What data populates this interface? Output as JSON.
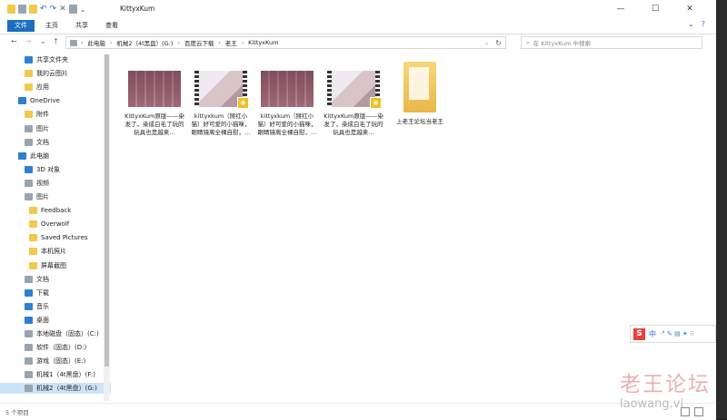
{
  "window": {
    "title": "KittyxKum",
    "controls": {
      "minimize": "—",
      "maximize": "☐",
      "close": "✕"
    }
  },
  "ribbon": {
    "tabs": [
      "文件",
      "主页",
      "共享",
      "查看"
    ]
  },
  "navigation": {
    "back": "←",
    "forward": "→",
    "recent": "⌄",
    "up": "↑",
    "breadcrumb": [
      "此电脑",
      "机械2（4t黑盘）(G:)",
      "百度云下载",
      "老王",
      "KittyxKum"
    ],
    "search_placeholder": "在 KittyxKum 中搜索"
  },
  "sidebar": {
    "items": [
      {
        "label": "共享文件夹",
        "icon": "share-icon",
        "level": 1
      },
      {
        "label": "我的云图片",
        "icon": "folder-icon",
        "level": 1
      },
      {
        "label": "应用",
        "icon": "folder-icon",
        "level": 1
      },
      {
        "label": "OneDrive",
        "icon": "cloud-icon",
        "level": 0
      },
      {
        "label": "附件",
        "icon": "folder-icon",
        "level": 1
      },
      {
        "label": "图片",
        "icon": "pictures-icon",
        "level": 1
      },
      {
        "label": "文档",
        "icon": "documents-icon",
        "level": 1
      },
      {
        "label": "此电脑",
        "icon": "computer-icon",
        "level": 0
      },
      {
        "label": "3D 对象",
        "icon": "cube-icon",
        "level": 1
      },
      {
        "label": "视频",
        "icon": "video-icon",
        "level": 1
      },
      {
        "label": "图片",
        "icon": "pictures-icon",
        "level": 1
      },
      {
        "label": "Feedback",
        "icon": "folder-icon",
        "level": 2
      },
      {
        "label": "Overwolf",
        "icon": "folder-icon",
        "level": 2
      },
      {
        "label": "Saved Pictures",
        "icon": "folder-icon",
        "level": 2
      },
      {
        "label": "本机照片",
        "icon": "folder-icon",
        "level": 2
      },
      {
        "label": "屏幕截图",
        "icon": "folder-icon",
        "level": 2
      },
      {
        "label": "文档",
        "icon": "documents-icon",
        "level": 1
      },
      {
        "label": "下载",
        "icon": "download-icon",
        "level": 1
      },
      {
        "label": "音乐",
        "icon": "music-icon",
        "level": 1
      },
      {
        "label": "桌面",
        "icon": "desktop-icon",
        "level": 1
      },
      {
        "label": "本地磁盘（固态）(C:)",
        "icon": "drive-icon",
        "level": 1
      },
      {
        "label": "软件（固态）(D:)",
        "icon": "drive-icon",
        "level": 1
      },
      {
        "label": "游戏（固态）(E:)",
        "icon": "drive-icon",
        "level": 1
      },
      {
        "label": "机械1（4t黑盘）(F:)",
        "icon": "drive-icon",
        "level": 1
      },
      {
        "label": "机械2（4t黑盘）(G:)",
        "icon": "drive-icon",
        "level": 1,
        "selected": true
      }
    ]
  },
  "files": [
    {
      "name": "KittyxKum原版——染发了，染成白毛了玩的玩具也是越来…",
      "kind": "grid"
    },
    {
      "name": "kittyxkum（掰红小猫）好可爱的小猫咪，眼睛镜离全裸自慰，…",
      "kind": "video"
    },
    {
      "name": "kittyxkum（掰红小猫）好可爱的小猫咪，眼睛镜离全裸自慰，…",
      "kind": "grid"
    },
    {
      "name": "KittyxKum原版——染发了，染成白毛了玩的玩具也是越来…",
      "kind": "video"
    },
    {
      "name": "上老王论坛当老王",
      "kind": "folder"
    }
  ],
  "status": {
    "count": "5 个项目"
  },
  "ime": {
    "logo": "S",
    "mode": "中",
    "extras": "·° ✎ ▤ ✦ ⁝⁝"
  },
  "watermark": {
    "line1": "老王论坛",
    "line2": "laowang.vi"
  }
}
